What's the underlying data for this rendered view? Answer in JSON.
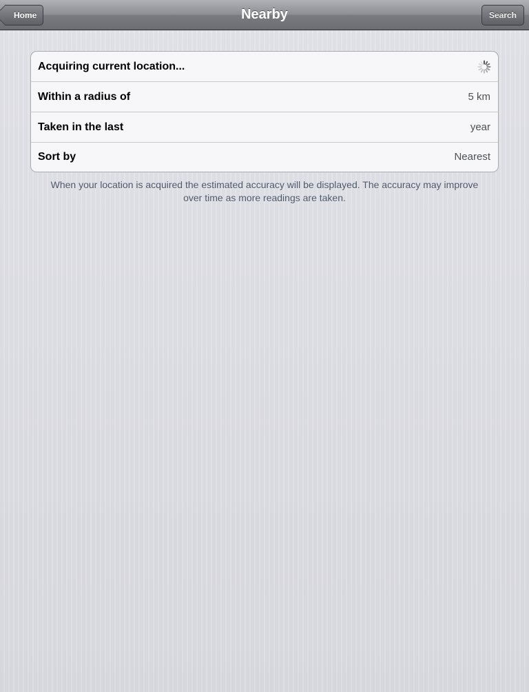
{
  "navbar": {
    "title": "Nearby",
    "back_label": "Home",
    "search_label": "Search"
  },
  "settings": {
    "rows": [
      {
        "label": "Acquiring current location...",
        "value": "",
        "icon": "activity-spinner-icon"
      },
      {
        "label": "Within a radius of",
        "value": "5 km"
      },
      {
        "label": "Taken in the last",
        "value": "year"
      },
      {
        "label": "Sort by",
        "value": "Nearest"
      }
    ],
    "footer": "When your location is acquired the estimated accuracy will be displayed. The accuracy may improve over time as more readings are taken."
  }
}
